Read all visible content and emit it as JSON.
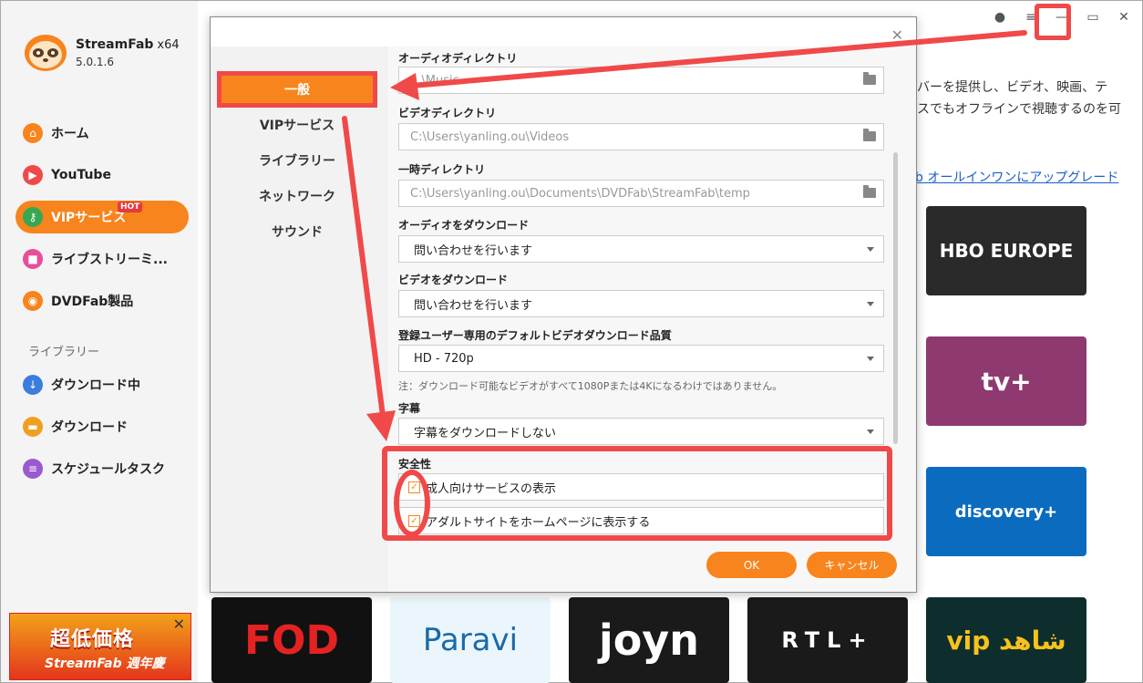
{
  "app": {
    "brand": "StreamFab",
    "arch": "x64",
    "version": "5.0.1.6"
  },
  "sidebar": {
    "items": [
      {
        "label": "ホーム",
        "icon": "home-icon",
        "color": "#f7841c"
      },
      {
        "label": "YouTube",
        "icon": "youtube-icon",
        "color": "#f04949"
      },
      {
        "label": "VIPサービス",
        "icon": "key-icon",
        "color": "#36a852",
        "badge": "HOT"
      },
      {
        "label": "ライブストリーミ...",
        "icon": "camera-icon",
        "color": "#e84d9a"
      },
      {
        "label": "DVDFab製品",
        "icon": "dvdfab-icon",
        "color": "#f7841c"
      }
    ],
    "library_label": "ライブラリー",
    "library_items": [
      {
        "label": "ダウンロード中",
        "icon": "download-icon",
        "color": "#3b7ddd"
      },
      {
        "label": "ダウンロード",
        "icon": "folder-icon",
        "color": "#f0a020"
      },
      {
        "label": "スケジュールタスク",
        "icon": "calendar-icon",
        "color": "#9b59d0"
      }
    ]
  },
  "promo": {
    "title": "超低価格",
    "subtitle": "StreamFab 週年慶"
  },
  "main": {
    "text_line1": "バーを提供し、ビデオ、映画、テ",
    "text_line2": "スでもオフラインで視聴するのを可",
    "upgrade_link": "b オールインワンにアップグレード",
    "tiles": [
      {
        "label": "HBO EUROPE",
        "bg": "#2a2a2a"
      },
      {
        "label": "tv+",
        "bg": "#8e3a70"
      },
      {
        "label": "discovery+",
        "bg": "#0b6cbf"
      },
      {
        "label": "FOD",
        "bg": "#111111"
      },
      {
        "label": "Paravi",
        "bg": "#eaf6fb"
      },
      {
        "label": "joyn",
        "bg": "#1a1a1a"
      },
      {
        "label": "RTL+",
        "bg": "#1a1a1a"
      },
      {
        "label": "vip شاهد",
        "bg": "#0e2e2e"
      }
    ]
  },
  "dialog": {
    "tabs": [
      "一般",
      "VIPサービス",
      "ライブラリー",
      "ネットワーク",
      "サウンド"
    ],
    "audio_dir_label": "オーディオディレクトリ",
    "audio_dir_value": "...\\Music",
    "video_dir_label": "ビデオディレクトリ",
    "video_dir_value": "C:\\Users\\yanling.ou\\Videos",
    "temp_dir_label": "一時ディレクトリ",
    "temp_dir_value": "C:\\Users\\yanling.ou\\Documents\\DVDFab\\StreamFab\\temp",
    "audio_dl_label": "オーディオをダウンロード",
    "audio_dl_value": "問い合わせを行います",
    "video_dl_label": "ビデオをダウンロード",
    "video_dl_value": "問い合わせを行います",
    "quality_label": "登録ユーザー専用のデフォルトビデオダウンロード品質",
    "quality_value": "HD - 720p",
    "quality_note": "注：ダウンロード可能なビデオがすべて1080Pまたは4Kになるわけではありません。",
    "subtitle_label": "字幕",
    "subtitle_value": "字幕をダウンロードしない",
    "safety_label": "安全性",
    "check1": "成人向けサービスの表示",
    "check2": "アダルトサイトをホームページに表示する",
    "ok": "OK",
    "cancel": "キャンセル"
  },
  "colors": {
    "accent": "#f7841c",
    "annotation": "#f04949"
  }
}
